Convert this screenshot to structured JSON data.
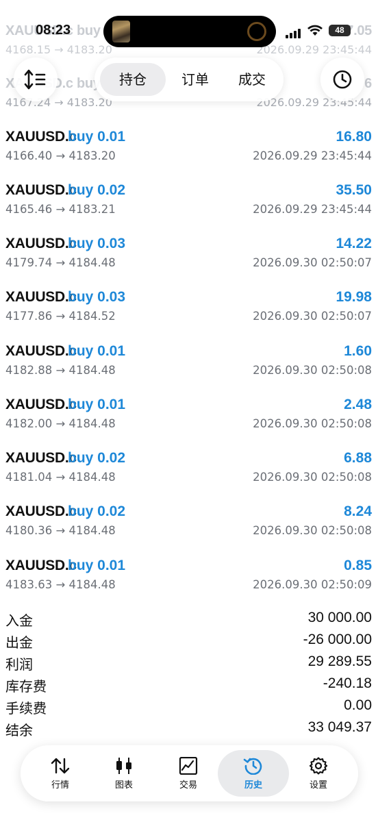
{
  "status": {
    "time": "08:23",
    "battery": "48"
  },
  "ghost_rows": [
    {
      "symbol": "XAUUSD.c buy 0.",
      "profit": "7.05",
      "prices": "4168.15 → 4183.20",
      "datetime": "2026.09.29 23:45:44"
    },
    {
      "symbol": "XAUUSD.c buy 0.",
      "profit": "6",
      "prices": "4167.24 → 4183.20",
      "datetime": "2026.09.29 23:45:44"
    }
  ],
  "tabs": [
    {
      "label": "持仓",
      "active": true
    },
    {
      "label": "订单",
      "active": false
    },
    {
      "label": "成交",
      "active": false
    }
  ],
  "deals": [
    {
      "symbol": "XAUUSD.c",
      "side": "buy 0.01",
      "profit": "16.80",
      "prices": "4166.40 → 4183.20",
      "datetime": "2026.09.29 23:45:44"
    },
    {
      "symbol": "XAUUSD.c",
      "side": "buy 0.02",
      "profit": "35.50",
      "prices": "4165.46 → 4183.21",
      "datetime": "2026.09.29 23:45:44"
    },
    {
      "symbol": "XAUUSD.c",
      "side": "buy 0.03",
      "profit": "14.22",
      "prices": "4179.74 → 4184.48",
      "datetime": "2026.09.30 02:50:07"
    },
    {
      "symbol": "XAUUSD.c",
      "side": "buy 0.03",
      "profit": "19.98",
      "prices": "4177.86 → 4184.52",
      "datetime": "2026.09.30 02:50:07"
    },
    {
      "symbol": "XAUUSD.c",
      "side": "buy 0.01",
      "profit": "1.60",
      "prices": "4182.88 → 4184.48",
      "datetime": "2026.09.30 02:50:08"
    },
    {
      "symbol": "XAUUSD.c",
      "side": "buy 0.01",
      "profit": "2.48",
      "prices": "4182.00 → 4184.48",
      "datetime": "2026.09.30 02:50:08"
    },
    {
      "symbol": "XAUUSD.c",
      "side": "buy 0.02",
      "profit": "6.88",
      "prices": "4181.04 → 4184.48",
      "datetime": "2026.09.30 02:50:08"
    },
    {
      "symbol": "XAUUSD.c",
      "side": "buy 0.02",
      "profit": "8.24",
      "prices": "4180.36 → 4184.48",
      "datetime": "2026.09.30 02:50:08"
    },
    {
      "symbol": "XAUUSD.c",
      "side": "buy 0.01",
      "profit": "0.85",
      "prices": "4183.63 → 4184.48",
      "datetime": "2026.09.30 02:50:09"
    }
  ],
  "summary": [
    {
      "label": "入金",
      "value": "30 000.00"
    },
    {
      "label": "出金",
      "value": "-26 000.00"
    },
    {
      "label": "利润",
      "value": "29 289.55"
    },
    {
      "label": "库存费",
      "value": "-240.18"
    },
    {
      "label": "手续费",
      "value": "0.00"
    },
    {
      "label": "结余",
      "value": "33 049.37"
    }
  ],
  "nav": [
    {
      "label": "行情",
      "icon": "quotes-icon",
      "active": false
    },
    {
      "label": "图表",
      "icon": "chart-icon",
      "active": false
    },
    {
      "label": "交易",
      "icon": "trade-icon",
      "active": false
    },
    {
      "label": "历史",
      "icon": "history-icon",
      "active": true
    },
    {
      "label": "设置",
      "icon": "settings-icon",
      "active": false
    }
  ],
  "colors": {
    "accent": "#1e88d8",
    "text": "#111111",
    "secondary": "#6b6f76"
  }
}
